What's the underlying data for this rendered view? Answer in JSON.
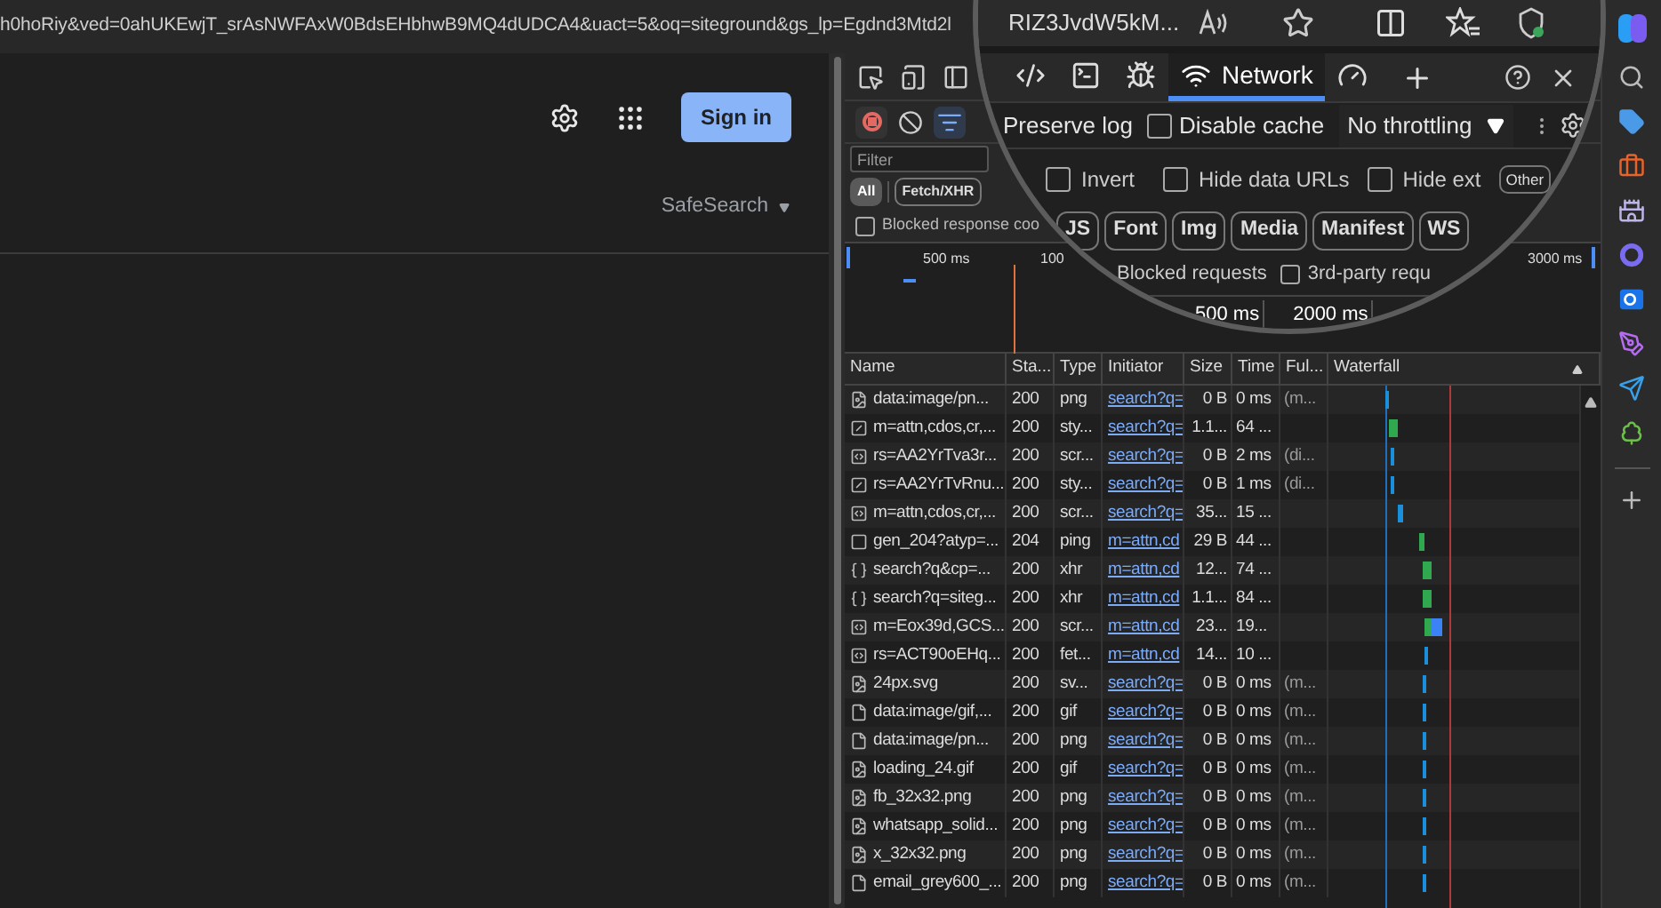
{
  "address_bar": {
    "url": "h0hoRiy&ved=0ahUKEwjT_srAsNWFAxW0BdsEHbhwB9MQ4dUDCA4&uact=5&oq=siteground&gs_lp=Egdnd3Mtd2l",
    "magnified_url": "RIZ3JvdW5kM..."
  },
  "page": {
    "sign_in": "Sign in",
    "safesearch": "SafeSearch"
  },
  "devtools": {
    "tabs": [
      {
        "kind": "elements",
        "selected": false
      },
      {
        "kind": "console",
        "selected": false
      },
      {
        "kind": "sources",
        "selected": false
      },
      {
        "kind": "network",
        "label": "Network",
        "selected": true
      },
      {
        "kind": "performance",
        "selected": false
      }
    ],
    "recording": true,
    "filter_open": true,
    "preserve_log": "Preserve log",
    "disable_cache": {
      "label": "Disable cache",
      "checked": false
    },
    "throttling": "No throttling",
    "filter": {
      "placeholder": "Filter"
    },
    "filter_options": [
      {
        "label": "Invert",
        "checked": false
      },
      {
        "label": "Hide data URLs",
        "checked": false
      },
      {
        "label": "Hide ext",
        "checked": false
      }
    ],
    "other_chip": {
      "label": "Other",
      "selected": false
    },
    "type_chips": [
      {
        "label": "All",
        "selected": true
      },
      {
        "label": "Fetch/XHR",
        "selected": false
      }
    ],
    "magnified_type_chips": [
      {
        "label": "JS",
        "selected": false
      },
      {
        "label": "Font",
        "selected": false
      },
      {
        "label": "Img",
        "selected": false
      },
      {
        "label": "Media",
        "selected": false
      },
      {
        "label": "Manifest",
        "selected": false
      },
      {
        "label": "WS",
        "selected": false
      }
    ],
    "blocked_response": {
      "label": "Blocked response coo",
      "checked": false
    },
    "blocked_requests": "Blocked requests",
    "third_party": {
      "label": "3rd-party requ",
      "checked": false
    },
    "overview_ticks": [
      "500 ms",
      "100",
      "3000 ms"
    ],
    "magnified_ticks": [
      "500 ms",
      "2000 ms"
    ],
    "table": {
      "columns": [
        "Name",
        "Sta...",
        "Type",
        "Initiator",
        "Size",
        "Time",
        "Ful...",
        "Waterfall"
      ],
      "rows": [
        {
          "kind": "image",
          "name": "data:image/pn...",
          "status": "200",
          "type": "png",
          "initiator": "search?q=",
          "size": "0 B",
          "time": "0 ms",
          "fulfilled": "(m..."
        },
        {
          "kind": "style",
          "name": "m=attn,cdos,cr,...",
          "status": "200",
          "type": "sty...",
          "initiator": "search?q=",
          "size": "1.1...",
          "time": "64 ..."
        },
        {
          "kind": "script",
          "name": "rs=AA2YrTva3r...",
          "status": "200",
          "type": "scr...",
          "initiator": "search?q=",
          "size": "0 B",
          "time": "2 ms",
          "fulfilled": "(di..."
        },
        {
          "kind": "style",
          "name": "rs=AA2YrTvRnu...",
          "status": "200",
          "type": "sty...",
          "initiator": "search?q=",
          "size": "0 B",
          "time": "1 ms",
          "fulfilled": "(di..."
        },
        {
          "kind": "script",
          "name": "m=attn,cdos,cr,...",
          "status": "200",
          "type": "scr...",
          "initiator": "search?q=",
          "size": "35...",
          "time": "15 ..."
        },
        {
          "kind": "ping",
          "name": "gen_204?atyp=...",
          "status": "204",
          "type": "ping",
          "initiator": "m=attn,cd",
          "size": "29 B",
          "time": "44 ..."
        },
        {
          "kind": "xhr",
          "name": "search?q&cp=...",
          "status": "200",
          "type": "xhr",
          "initiator": "m=attn,cd",
          "size": "12...",
          "time": "74 ..."
        },
        {
          "kind": "xhr",
          "name": "search?q=siteg...",
          "status": "200",
          "type": "xhr",
          "initiator": "m=attn,cd",
          "size": "1.1...",
          "time": "84 ..."
        },
        {
          "kind": "script",
          "name": "m=Eox39d,GCS...",
          "status": "200",
          "type": "scr...",
          "initiator": "m=attn,cd",
          "size": "23...",
          "time": "19..."
        },
        {
          "kind": "script",
          "name": "rs=ACT90oEHq...",
          "status": "200",
          "type": "fet...",
          "initiator": "m=attn,cd",
          "size": "14...",
          "time": "10 ..."
        },
        {
          "kind": "image",
          "name": "24px.svg",
          "status": "200",
          "type": "sv...",
          "initiator": "search?q=",
          "size": "0 B",
          "time": "0 ms",
          "fulfilled": "(m..."
        },
        {
          "kind": "file",
          "name": "data:image/gif,...",
          "status": "200",
          "type": "gif",
          "initiator": "search?q=",
          "size": "0 B",
          "time": "0 ms",
          "fulfilled": "(m..."
        },
        {
          "kind": "file",
          "name": "data:image/pn...",
          "status": "200",
          "type": "png",
          "initiator": "search?q=",
          "size": "0 B",
          "time": "0 ms",
          "fulfilled": "(m..."
        },
        {
          "kind": "image",
          "name": "loading_24.gif",
          "status": "200",
          "type": "gif",
          "initiator": "search?q=",
          "size": "0 B",
          "time": "0 ms",
          "fulfilled": "(m..."
        },
        {
          "kind": "image",
          "name": "fb_32x32.png",
          "status": "200",
          "type": "png",
          "initiator": "search?q=",
          "size": "0 B",
          "time": "0 ms",
          "fulfilled": "(m..."
        },
        {
          "kind": "image",
          "name": "whatsapp_solid...",
          "status": "200",
          "type": "png",
          "initiator": "search?q=",
          "size": "0 B",
          "time": "0 ms",
          "fulfilled": "(m..."
        },
        {
          "kind": "image",
          "name": "x_32x32.png",
          "status": "200",
          "type": "png",
          "initiator": "search?q=",
          "size": "0 B",
          "time": "0 ms",
          "fulfilled": "(m..."
        },
        {
          "kind": "file",
          "name": "email_grey600_...",
          "status": "200",
          "type": "png",
          "initiator": "search?q=",
          "size": "0 B",
          "time": "0 ms",
          "fulfilled": "(m..."
        }
      ]
    }
  }
}
